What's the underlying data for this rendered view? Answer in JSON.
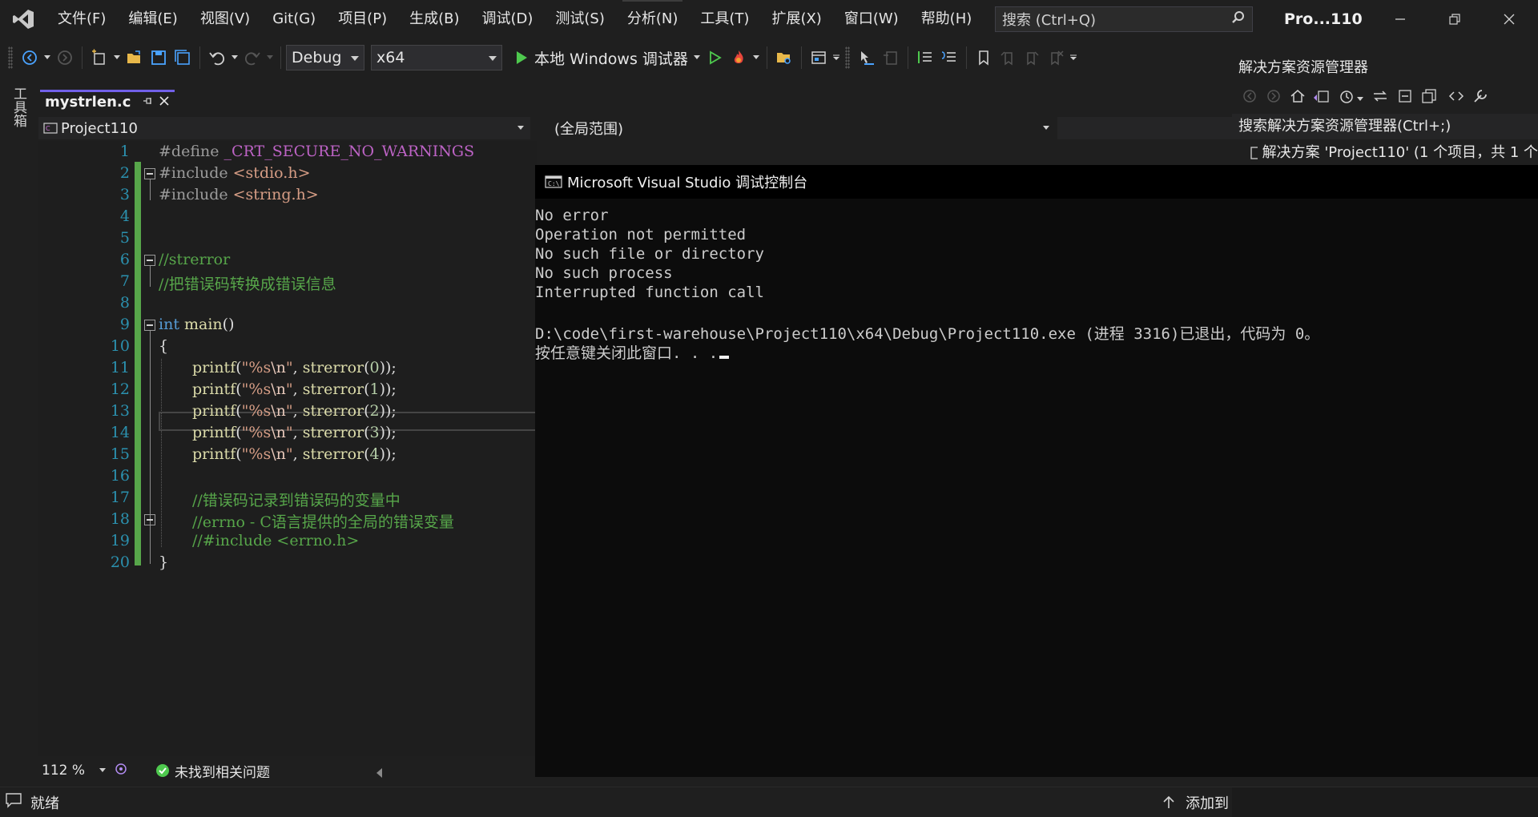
{
  "menubar": {
    "items": [
      "文件(F)",
      "编辑(E)",
      "视图(V)",
      "Git(G)",
      "项目(P)",
      "生成(B)",
      "调试(D)",
      "测试(S)",
      "分析(N)",
      "工具(T)",
      "扩展(X)",
      "窗口(W)",
      "帮助(H)"
    ],
    "search_placeholder": "搜索 (Ctrl+Q)",
    "project_title": "Pro...110"
  },
  "toolbar": {
    "configuration": "Debug",
    "platform": "x64",
    "run_label": "本地 Windows 调试器"
  },
  "toolbox": {
    "label": "工具箱"
  },
  "document_tab": {
    "name": "mystrlen.c"
  },
  "navbar": {
    "project": "Project110",
    "scope": "(全局范围)"
  },
  "editor": {
    "line_numbers": [
      "1",
      "2",
      "3",
      "4",
      "5",
      "6",
      "7",
      "8",
      "9",
      "10",
      "11",
      "12",
      "13",
      "14",
      "15",
      "16",
      "17",
      "18",
      "19",
      "20"
    ],
    "code": {
      "l1_pp": "#define ",
      "l1_macro": "_CRT_SECURE_NO_WARNINGS",
      "l2_pp": "#include ",
      "l2_str": "<stdio.h>",
      "l3_pp": "#include ",
      "l3_str": "<string.h>",
      "l6": "//strerror",
      "l7": "//把错误码转换成错误信息",
      "l9_kw": "int",
      "l9_fn": " main",
      "l9_rest": "()",
      "l10": "{",
      "printf_fn": "printf",
      "printf_open": "(",
      "printf_fmt": "\"%s",
      "printf_esc": "\\n",
      "printf_fmt_end": "\"",
      "printf_comma": ", ",
      "strerror_fn": "strerror",
      "args": [
        "0",
        "1",
        "2",
        "3",
        "4"
      ],
      "printf_close": "));",
      "l17": "//错误码记录到错误码的变量中",
      "l18": "//errno - C语言提供的全局的错误变量",
      "l19": "//#include <errno.h>",
      "l20": "}"
    }
  },
  "editor_status": {
    "zoom": "112 %",
    "issues": "未找到相关问题"
  },
  "console": {
    "title": "Microsoft Visual Studio 调试控制台",
    "lines": [
      "No error",
      "Operation not permitted",
      "No such file or directory",
      "No such process",
      "Interrupted function call",
      "",
      "D:\\code\\first-warehouse\\Project110\\x64\\Debug\\Project110.exe (进程 3316)已退出，代码为 0。",
      "按任意键关闭此窗口. . ."
    ]
  },
  "solution_explorer": {
    "title": "解决方案资源管理器",
    "search_placeholder": "搜索解决方案资源管理器(Ctrl+;)",
    "root_item": "解决方案 'Project110' (1 个项目，共 1 个"
  },
  "statusbar": {
    "ready": "就绪",
    "add_to_source": "添加到"
  },
  "colors": {
    "accent": "#7160e8",
    "changed_lines": "#57a64a",
    "line_numbers": "#2b91af",
    "keyword": "#569cd6",
    "comment": "#57a64a",
    "string": "#d69d85",
    "macro": "#bd63c5",
    "run_green": "#4ec94e"
  }
}
